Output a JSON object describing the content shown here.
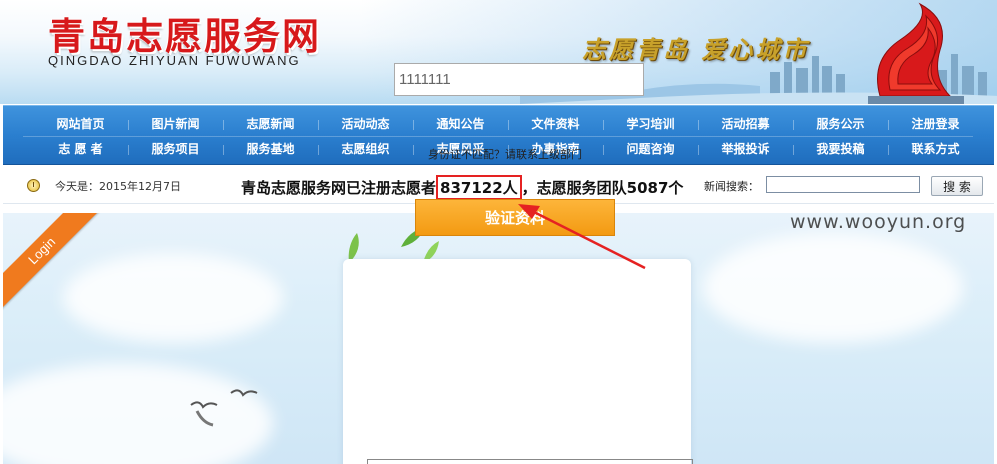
{
  "header": {
    "title": "青岛志愿服务网",
    "subtitle": "QINGDAO ZHIYUAN FUWUWANG",
    "slogan": "志愿青岛 爱心城市"
  },
  "nav": {
    "row1": [
      "网站首页",
      "图片新闻",
      "志愿新闻",
      "活动动态",
      "通知公告",
      "文件资料",
      "学习培训",
      "活动招募",
      "服务公示",
      "注册登录"
    ],
    "row2": [
      "志 愿 者",
      "服务项目",
      "服务基地",
      "志愿组织",
      "志愿风采",
      "办事指南",
      "问题咨询",
      "举报投诉",
      "我要投稿",
      "联系方式"
    ]
  },
  "infobar": {
    "today": "今天是：2015年12月7日",
    "reg_prefix": "青岛志愿服务网已注册志愿者",
    "reg_count": "837122人",
    "reg_suffix": "，志愿服务团队5087个",
    "search_label": "新闻搜索：",
    "search_value": "",
    "search_button": "搜 索"
  },
  "login": {
    "ribbon": "Login",
    "id_value": "1111111",
    "mismatch_text": "身份证不匹配？请联系上级部门",
    "verify_button": "验证资料"
  },
  "watermark": "www.wooyun.org",
  "colors": {
    "title_red": "#d7191b",
    "nav_blue": "#2b7fcf",
    "ribbon_orange": "#f07a1e",
    "button_orange": "#f7a42a",
    "annotation_red": "#e52222"
  }
}
